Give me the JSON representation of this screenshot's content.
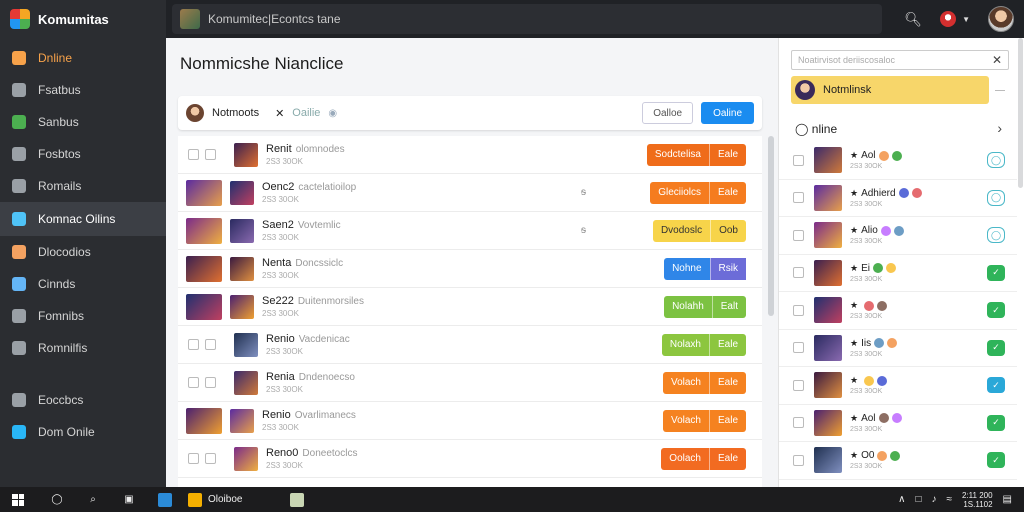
{
  "sidebar": {
    "brand": "Komumitas",
    "items": [
      {
        "label": "Dnline",
        "icon": "home-icon",
        "color": "#f7a24a"
      },
      {
        "label": "Fsatbus",
        "icon": "list-icon",
        "color": "#9aa0a6"
      },
      {
        "label": "Sanbus",
        "icon": "chart-icon",
        "color": "#4caf50"
      },
      {
        "label": "Fosbtos",
        "icon": "video-icon",
        "color": "#9aa0a6"
      },
      {
        "label": "Romails",
        "icon": "search-icon",
        "color": "#9aa0a6"
      },
      {
        "label": "Komnac Oilins",
        "icon": "chat-icon",
        "color": "#4fc3f7"
      },
      {
        "label": "Dlocodios",
        "icon": "people-icon",
        "color": "#f4a261"
      },
      {
        "label": "Cinnds",
        "icon": "tree-icon",
        "color": "#64b5f6"
      },
      {
        "label": "Fomnibs",
        "icon": "user-icon",
        "color": "#9aa0a6"
      },
      {
        "label": "Romnilfis",
        "icon": "globe-icon",
        "color": "#9aa0a6"
      },
      {
        "label": "Eoccbcs",
        "icon": "grid-icon",
        "color": "#9aa0a6"
      },
      {
        "label": "Dom Onile",
        "icon": "circle-icon",
        "color": "#29b6f6"
      }
    ]
  },
  "topbar": {
    "search_text": "Komumitec|Econtcs tane"
  },
  "main": {
    "title": "Nommicshe Nianclice",
    "head": {
      "name": "Notmoots",
      "status": "Oailie",
      "ghost_label": "Oalloe",
      "primary_label": "Oaline"
    },
    "rows": [
      {
        "title": "Renit",
        "sub": "olomnodes",
        "meta": "2S3 30OK",
        "badge_l": "Sodctelisa",
        "badge_r": "Eale",
        "color": "#ef6c1a",
        "mark": ""
      },
      {
        "title": "Oenc2",
        "sub": "cactelatioilop",
        "meta": "2S3 30OK",
        "badge_l": "Gleciiolcs",
        "badge_r": "Eale",
        "color": "#f57c1f",
        "mark": "ᵴ"
      },
      {
        "title": "Saen2",
        "sub": "Vovtemlic",
        "meta": "2S3 30OK",
        "badge_l": "Dvodoslc",
        "badge_r": "Oob",
        "color": "#f7d44a",
        "mark": "ᵴ"
      },
      {
        "title": "Nenta",
        "sub": "Doncssiclc",
        "meta": "2S3 30OK",
        "badge_l": "Nohne",
        "badge_r": "Rsik",
        "color": "#2f86e8",
        "mark": ""
      },
      {
        "title": "Se222",
        "sub": "Duitenmorsiles",
        "meta": "2S3 30OK",
        "badge_l": "Nolahh",
        "badge_r": "Ealt",
        "color": "#7cc242",
        "mark": ""
      },
      {
        "title": "Renio",
        "sub": "Vacdenicac",
        "meta": "2S3 30OK",
        "badge_l": "Nolaxh",
        "badge_r": "Eale",
        "color": "#8cc63f",
        "mark": ""
      },
      {
        "title": "Renia",
        "sub": "Dndenoecso",
        "meta": "2S3 30OK",
        "badge_l": "Volach",
        "badge_r": "Eale",
        "color": "#f58220",
        "mark": ""
      },
      {
        "title": "Renio",
        "sub": "Ovarlimanecs",
        "meta": "2S3 30OK",
        "badge_l": "Volach",
        "badge_r": "Eale",
        "color": "#f58220",
        "mark": ""
      },
      {
        "title": "Reno0",
        "sub": "Doneetoclcs",
        "meta": "2S3 30OK",
        "badge_l": "Oolach",
        "badge_r": "Eale",
        "color": "#f26b21",
        "mark": ""
      }
    ]
  },
  "right": {
    "search_placeholder": "Noatirvisot deriiscosaloc",
    "card_label": "Notmlinsk",
    "online_label": "nline",
    "rows": [
      {
        "name": "Aol",
        "meta": "2S3 30OK",
        "status": "ring"
      },
      {
        "name": "Adhierd",
        "meta": "2S3 30OK",
        "status": "ring"
      },
      {
        "name": "Alio",
        "meta": "2S3 30OK",
        "status": "ring"
      },
      {
        "name": "Ei",
        "meta": "2S3 30OK",
        "status": "green"
      },
      {
        "name": "",
        "meta": "2S3 30OK",
        "status": "green"
      },
      {
        "name": "Iis",
        "meta": "2S3 30OK",
        "status": "green"
      },
      {
        "name": "",
        "meta": "2S3 30OK",
        "status": "teal"
      },
      {
        "name": "Aol",
        "meta": "2S3 30OK",
        "status": "green"
      },
      {
        "name": "O0",
        "meta": "2S3 30OK",
        "status": "green"
      }
    ]
  },
  "taskbar": {
    "app_label": "Oloiboe",
    "time": "2:11 200",
    "date": "1S.1102"
  }
}
